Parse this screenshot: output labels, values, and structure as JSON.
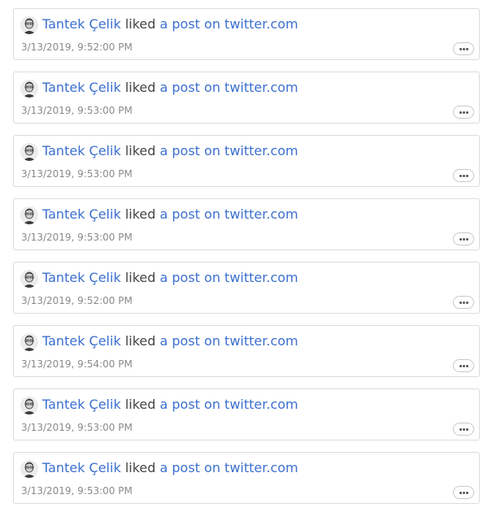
{
  "posts": [
    {
      "author": "Tantek Çelik",
      "action": "liked",
      "target": "a post on twitter.com",
      "timestamp": "3/13/2019, 9:52:00 PM"
    },
    {
      "author": "Tantek Çelik",
      "action": "liked",
      "target": "a post on twitter.com",
      "timestamp": "3/13/2019, 9:53:00 PM"
    },
    {
      "author": "Tantek Çelik",
      "action": "liked",
      "target": "a post on twitter.com",
      "timestamp": "3/13/2019, 9:53:00 PM"
    },
    {
      "author": "Tantek Çelik",
      "action": "liked",
      "target": "a post on twitter.com",
      "timestamp": "3/13/2019, 9:53:00 PM"
    },
    {
      "author": "Tantek Çelik",
      "action": "liked",
      "target": "a post on twitter.com",
      "timestamp": "3/13/2019, 9:52:00 PM"
    },
    {
      "author": "Tantek Çelik",
      "action": "liked",
      "target": "a post on twitter.com",
      "timestamp": "3/13/2019, 9:54:00 PM"
    },
    {
      "author": "Tantek Çelik",
      "action": "liked",
      "target": "a post on twitter.com",
      "timestamp": "3/13/2019, 9:53:00 PM"
    },
    {
      "author": "Tantek Çelik",
      "action": "liked",
      "target": "a post on twitter.com",
      "timestamp": "3/13/2019, 9:53:00 PM"
    }
  ],
  "icons": {
    "avatar": "user-avatar",
    "more": "ellipsis-icon"
  },
  "colors": {
    "link": "#3b6fcf",
    "text": "#444444",
    "muted": "#8a8a8a",
    "border": "#dcdcdc"
  }
}
